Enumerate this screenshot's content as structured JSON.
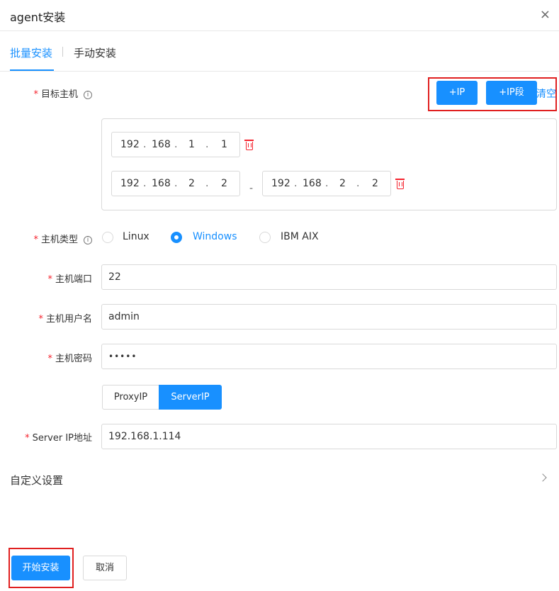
{
  "dialog": {
    "title": "agent安装",
    "close_symbol": "×"
  },
  "tabs": [
    {
      "label": "批量安装",
      "active": true
    },
    {
      "label": "手动安装",
      "active": false
    }
  ],
  "target_host": {
    "label": "目标主机",
    "required_mark": "*",
    "info_symbol": "i",
    "add_ip_button": "+IP",
    "add_ip_range_button": "+IP段",
    "clear_link": "清空",
    "single_ip": [
      "192",
      "168",
      "1",
      "1"
    ],
    "range_start": [
      "192",
      "168",
      "2",
      "2"
    ],
    "range_separator": "-",
    "range_end": [
      "192",
      "168",
      "2",
      "2"
    ],
    "octet_separator": "."
  },
  "host_type": {
    "label": "主机类型",
    "options": [
      "Linux",
      "Windows",
      "IBM AIX"
    ],
    "selected": "Windows"
  },
  "host_port": {
    "label": "主机端口",
    "value": "22"
  },
  "host_username": {
    "label": "主机用户名",
    "value": "admin"
  },
  "host_password": {
    "label": "主机密码",
    "value": "•••••"
  },
  "ip_mode": {
    "options": [
      "ProxyIP",
      "ServerIP"
    ],
    "selected": "ServerIP"
  },
  "server_ip": {
    "label": "Server IP地址",
    "value": "192.168.1.114"
  },
  "custom_settings": {
    "label": "自定义设置"
  },
  "footer": {
    "start_button": "开始安装",
    "cancel_button": "取消"
  },
  "colors": {
    "primary": "#1890ff",
    "required": "#f5222d",
    "highlight_box": "#e02020",
    "border": "#d9d9d9"
  }
}
